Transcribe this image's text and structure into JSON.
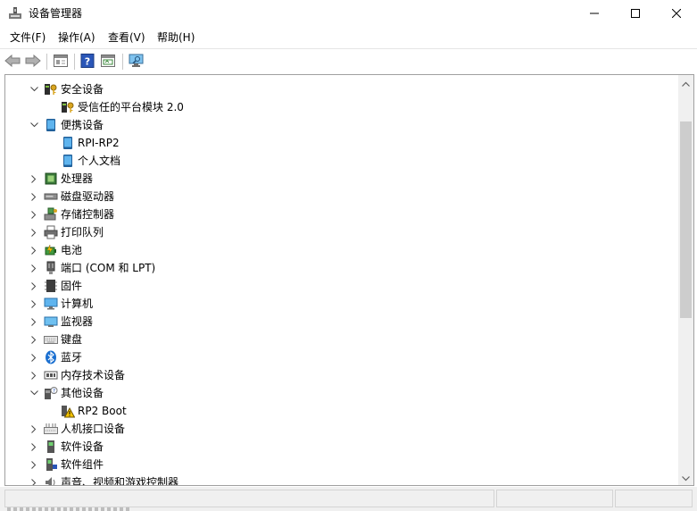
{
  "window": {
    "title": "设备管理器",
    "controls": {
      "minimize": "—",
      "maximize": "☐",
      "close": "✕"
    }
  },
  "menu": {
    "items": [
      "文件(F)",
      "操作(A)",
      "查看(V)",
      "帮助(H)"
    ]
  },
  "toolbar": {
    "buttons": [
      "back-arrow-icon",
      "forward-arrow-icon",
      "properties-icon",
      "help-icon",
      "view-icon",
      "scan-monitor-icon"
    ]
  },
  "tree": {
    "nodes": [
      {
        "label": "安全设备",
        "expanded": true,
        "icon": "security-key-icon",
        "children": [
          "受信任的平台模块 2.0"
        ]
      },
      {
        "label": "便携设备",
        "expanded": true,
        "icon": "portable-device-icon",
        "children": [
          "RPI-RP2",
          "个人文档"
        ]
      },
      {
        "label": "处理器",
        "expanded": false,
        "icon": "processor-icon"
      },
      {
        "label": "磁盘驱动器",
        "expanded": false,
        "icon": "disk-drive-icon"
      },
      {
        "label": "存储控制器",
        "expanded": false,
        "icon": "storage-controller-icon"
      },
      {
        "label": "打印队列",
        "expanded": false,
        "icon": "printer-icon"
      },
      {
        "label": "电池",
        "expanded": false,
        "icon": "battery-icon"
      },
      {
        "label": "端口 (COM 和 LPT)",
        "expanded": false,
        "icon": "port-icon"
      },
      {
        "label": "固件",
        "expanded": false,
        "icon": "firmware-icon"
      },
      {
        "label": "计算机",
        "expanded": false,
        "icon": "computer-icon"
      },
      {
        "label": "监视器",
        "expanded": false,
        "icon": "monitor-icon"
      },
      {
        "label": "键盘",
        "expanded": false,
        "icon": "keyboard-icon"
      },
      {
        "label": "蓝牙",
        "expanded": false,
        "icon": "bluetooth-icon"
      },
      {
        "label": "内存技术设备",
        "expanded": false,
        "icon": "memory-device-icon"
      },
      {
        "label": "其他设备",
        "expanded": true,
        "icon": "other-device-icon",
        "children": [
          "RP2 Boot"
        ]
      },
      {
        "label": "人机接口设备",
        "expanded": false,
        "icon": "hid-icon"
      },
      {
        "label": "软件设备",
        "expanded": false,
        "icon": "software-device-icon"
      },
      {
        "label": "软件组件",
        "expanded": false,
        "icon": "software-component-icon"
      },
      {
        "label": "声音、视频和游戏控制器",
        "expanded": false,
        "icon": "sound-icon"
      }
    ]
  },
  "colors": {
    "accent": "#0078d7",
    "warning": "#f5c400"
  }
}
